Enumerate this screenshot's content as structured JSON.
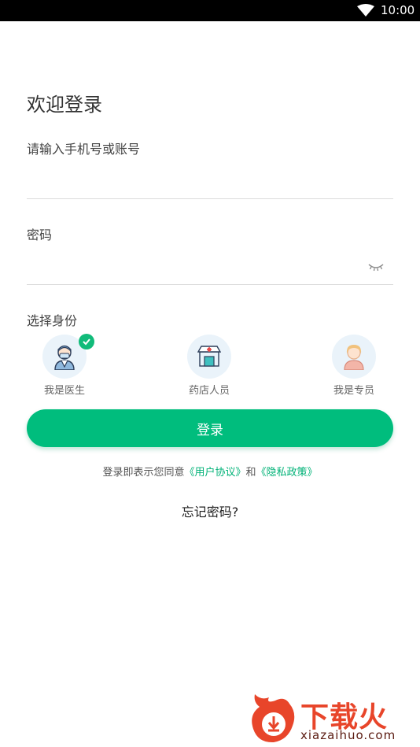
{
  "status_bar": {
    "time": "10:00",
    "wifi_icon": "wifi-icon"
  },
  "title": "欢迎登录",
  "account": {
    "label": "请输入手机号或账号",
    "value": ""
  },
  "password": {
    "label": "密码",
    "value": "",
    "toggle_icon": "eye-closed-icon"
  },
  "role_section": {
    "label": "选择身份",
    "roles": [
      {
        "label": "我是医生",
        "icon": "doctor-avatar-icon",
        "selected": true
      },
      {
        "label": "药店人员",
        "icon": "pharmacy-store-icon",
        "selected": false
      },
      {
        "label": "我是专员",
        "icon": "specialist-avatar-icon",
        "selected": false
      }
    ]
  },
  "login_button": "登录",
  "agreement": {
    "prefix": "登录即表示您同意",
    "user_agreement": "《用户协议》",
    "and": "和",
    "privacy_policy": "《隐私政策》"
  },
  "forgot_password": "忘记密码?",
  "watermark": {
    "brand": "下载火",
    "url": "xiazaihuo.com"
  },
  "colors": {
    "accent": "#00bd7d",
    "link": "#00b277",
    "avatar_bg": "#eaf3fa",
    "watermark": "#e8452a"
  }
}
